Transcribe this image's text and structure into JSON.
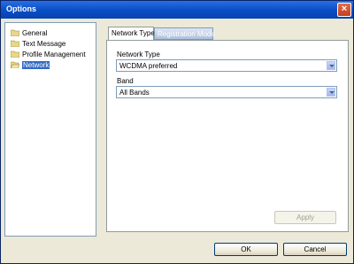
{
  "window": {
    "title": "Options"
  },
  "tree": {
    "items": [
      {
        "label": "General"
      },
      {
        "label": "Text Message"
      },
      {
        "label": "Profile Management"
      },
      {
        "label": "Network"
      }
    ]
  },
  "tabs": [
    {
      "label": "Network Type"
    },
    {
      "label": "Registration Mode"
    }
  ],
  "form": {
    "network_type_label": "Network Type",
    "network_type_value": "WCDMA preferred",
    "band_label": "Band",
    "band_value": "All Bands",
    "apply_label": "Apply"
  },
  "footer": {
    "ok_label": "OK",
    "cancel_label": "Cancel"
  }
}
